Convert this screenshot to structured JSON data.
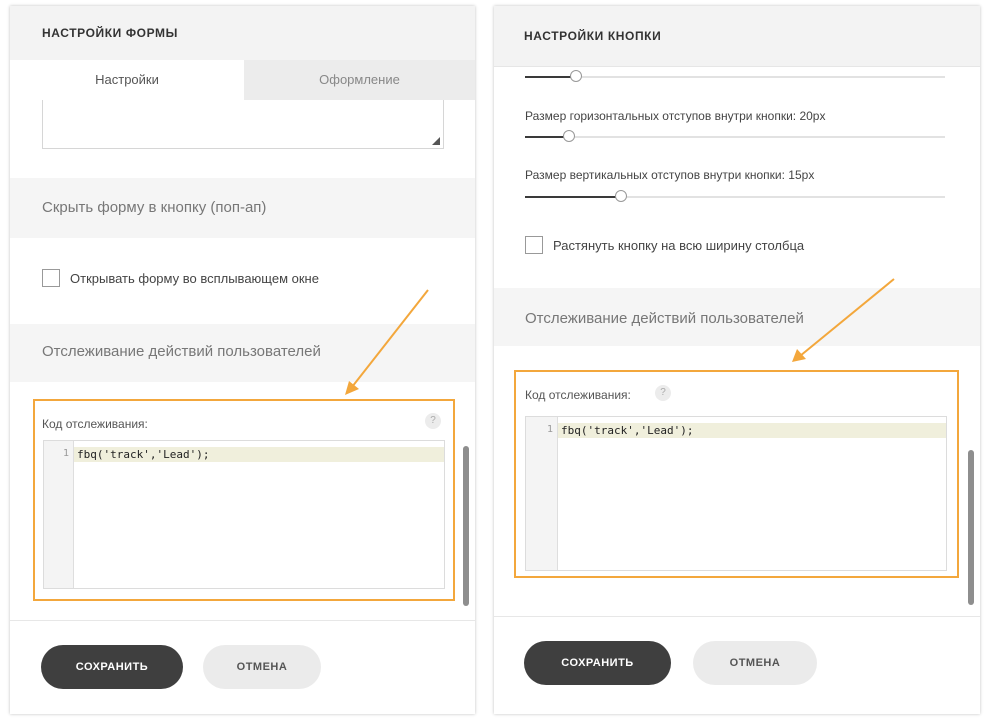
{
  "left_panel": {
    "title": "НАСТРОЙКИ ФОРМЫ",
    "tabs": [
      {
        "label": "Настройки",
        "active": true
      },
      {
        "label": "Оформление",
        "active": false
      }
    ],
    "popup_section": {
      "heading": "Скрыть форму в кнопку (поп-ап)",
      "checkbox_label": "Открывать форму во всплывающем окне",
      "checked": false
    },
    "tracking_section": {
      "heading": "Отслеживание действий пользователей",
      "field_label": "Код отслеживания:",
      "help": "?",
      "line_number": "1",
      "code": "fbq('track','Lead');"
    },
    "buttons": {
      "save": "СОХРАНИТЬ",
      "cancel": "ОТМЕНА"
    }
  },
  "right_panel": {
    "title": "НАСТРОЙКИ КНОПКИ",
    "sliders": [
      {
        "label": "",
        "value_fraction": 0.12
      },
      {
        "label": "Размер горизонтальных отступов внутри кнопки: 20px",
        "value_fraction": 0.1
      },
      {
        "label": "Размер вертикальных отступов внутри кнопки: 15px",
        "value_fraction": 0.22
      }
    ],
    "stretch_checkbox": {
      "label": "Растянуть кнопку на всю ширину столбца",
      "checked": false
    },
    "tracking_section": {
      "heading": "Отслеживание действий пользователей",
      "field_label": "Код отслеживания:",
      "help": "?",
      "line_number": "1",
      "code": "fbq('track','Lead');"
    },
    "buttons": {
      "save": "СОХРАНИТЬ",
      "cancel": "ОТМЕНА"
    }
  },
  "colors": {
    "highlight": "#f3a73c",
    "arrow": "#f3a73c",
    "primary_button": "#3f3f3f"
  }
}
